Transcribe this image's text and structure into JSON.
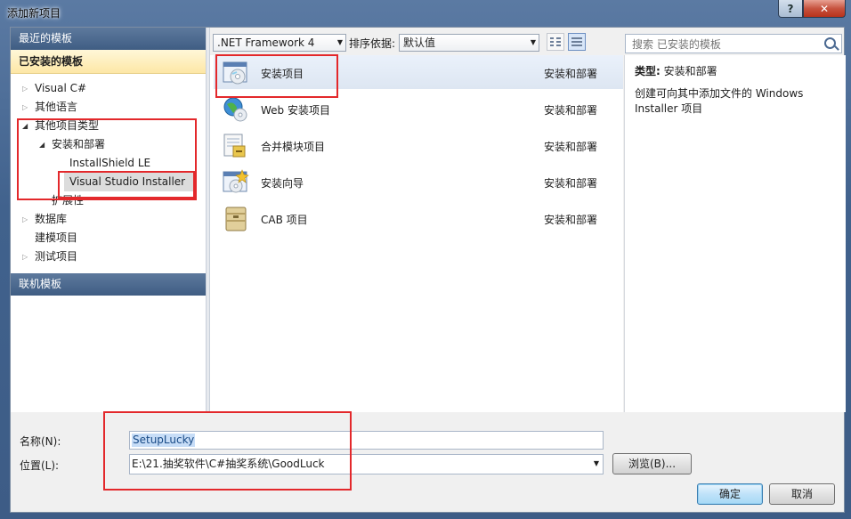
{
  "window": {
    "title": "添加新项目",
    "help": "?",
    "close": "✕"
  },
  "left": {
    "recent_header": "最近的模板",
    "installed_header": "已安装的模板",
    "tree": [
      {
        "label": "Visual C#",
        "depth": 0,
        "arrow": "collapsed"
      },
      {
        "label": "其他语言",
        "depth": 0,
        "arrow": "collapsed"
      },
      {
        "label": "其他项目类型",
        "depth": 0,
        "arrow": "expanded"
      },
      {
        "label": "安装和部署",
        "depth": 1,
        "arrow": "expanded"
      },
      {
        "label": "InstallShield LE",
        "depth": 2,
        "arrow": "none"
      },
      {
        "label": "Visual Studio Installer",
        "depth": 2,
        "arrow": "none",
        "selected": true
      },
      {
        "label": "扩展性",
        "depth": 1,
        "arrow": "none"
      },
      {
        "label": "数据库",
        "depth": 0,
        "arrow": "collapsed"
      },
      {
        "label": "建模项目",
        "depth": 0,
        "arrow": "none"
      },
      {
        "label": "测试项目",
        "depth": 0,
        "arrow": "collapsed"
      }
    ],
    "online_header": "联机模板"
  },
  "toolbar": {
    "framework": ".NET Framework 4",
    "sort_label": "排序依据:",
    "sort_value": "默认值",
    "search_placeholder": "搜索 已安装的模板"
  },
  "templates": [
    {
      "name": "安装项目",
      "category": "安装和部署",
      "icon": "setup-project-icon"
    },
    {
      "name": "Web 安装项目",
      "category": "安装和部署",
      "icon": "web-setup-project-icon"
    },
    {
      "name": "合并模块项目",
      "category": "安装和部署",
      "icon": "merge-module-icon"
    },
    {
      "name": "安装向导",
      "category": "安装和部署",
      "icon": "setup-wizard-icon"
    },
    {
      "name": "CAB 项目",
      "category": "安装和部署",
      "icon": "cab-project-icon"
    }
  ],
  "details": {
    "type_label": "类型:",
    "type_value": "安装和部署",
    "description": "创建可向其中添加文件的 Windows Installer 项目"
  },
  "bottom": {
    "name_label": "名称(N):",
    "name_value": "SetupLucky",
    "location_label": "位置(L):",
    "location_value": "E:\\21.抽奖软件\\C#抽奖系统\\GoodLuck",
    "browse": "浏览(B)...",
    "ok": "确定",
    "cancel": "取消"
  },
  "colors": {
    "annotation": "#e3282b",
    "header": "#4a6890",
    "selection": "#fde7a6"
  }
}
